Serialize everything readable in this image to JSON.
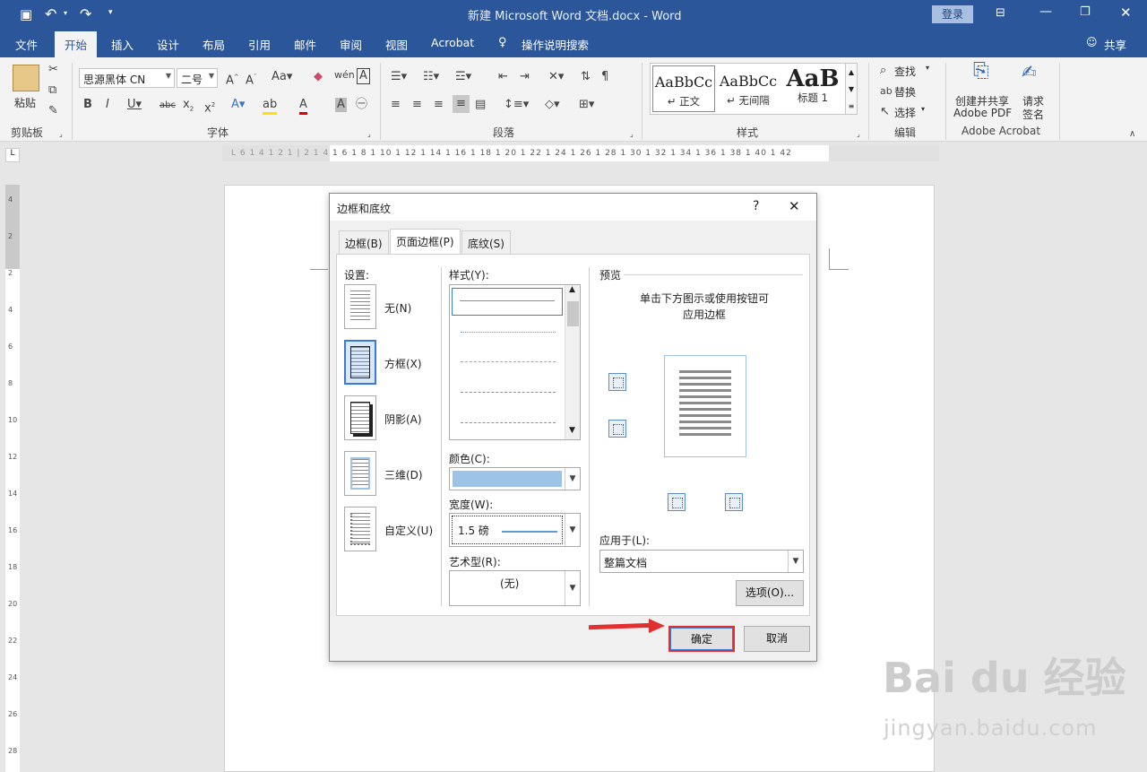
{
  "titlebar": {
    "title": "新建 Microsoft Word 文档.docx - Word",
    "login": "登录"
  },
  "tabs": [
    "文件",
    "开始",
    "插入",
    "设计",
    "布局",
    "引用",
    "邮件",
    "审阅",
    "视图",
    "Acrobat",
    "操作说明搜索",
    "共享"
  ],
  "ribbon": {
    "paste": "粘贴",
    "clipboard": "剪贴板",
    "font_name": "思源黑体 CN",
    "font_size": "二号",
    "font_group": "字体",
    "para_group": "段落",
    "styles": [
      {
        "preview": "AaBbCc",
        "name": "↵ 正文"
      },
      {
        "preview": "AaBbCc",
        "name": "↵ 无间隔"
      },
      {
        "preview": "AaB",
        "name": "标题 1"
      }
    ],
    "styles_group": "样式",
    "find": "查找",
    "replace": "替换",
    "select": "选择",
    "edit_group": "编辑",
    "pdf_line1": "创建并共享",
    "pdf_line2": "Adobe PDF",
    "sign_line1": "请求",
    "sign_line2": "签名",
    "acrobat_group": "Adobe Acrobat"
  },
  "ruler_text": "L 6 1 4 1 2 1 | 2 1 4 1 6 1 8 1 10 1 12 1 14 1 16 1 18 1 20 1 22 1 24 1 26 1 28 1 30 1 32 1 34 1 36 1 38 1 40 1 42",
  "dialog": {
    "title": "边框和底纹",
    "help": "?",
    "close": "✕",
    "tabs": [
      "边框(B)",
      "页面边框(P)",
      "底纹(S)"
    ],
    "settings_label": "设置:",
    "settings": [
      "无(N)",
      "方框(X)",
      "阴影(A)",
      "三维(D)",
      "自定义(U)"
    ],
    "style_label": "样式(Y):",
    "color_label": "颜色(C):",
    "width_label": "宽度(W):",
    "width_value": "1.5 磅",
    "art_label": "艺术型(R):",
    "art_value": "(无)",
    "preview_label": "预览",
    "preview_hint": [
      "单击下方图示或使用按钮可",
      "应用边框"
    ],
    "apply_label": "应用于(L):",
    "apply_value": "整篇文档",
    "options_btn": "选项(O)...",
    "ok": "确定",
    "cancel": "取消"
  },
  "colors": {
    "ribbon_blue": "#2b579a",
    "border_color": "#9dc3e6",
    "highlight": "#e03030"
  },
  "watermark": {
    "brand": "Bai du 经验",
    "url": "jingyan.baidu.com"
  }
}
